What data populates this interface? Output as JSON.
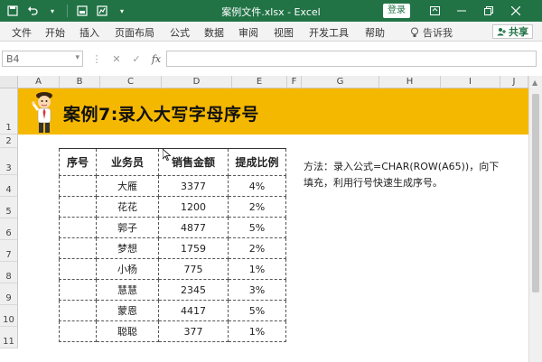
{
  "titlebar": {
    "doc_title": "案例文件.xlsx  -  Excel",
    "login_label": "登录"
  },
  "ribbon": {
    "tabs": [
      "文件",
      "开始",
      "插入",
      "页面布局",
      "公式",
      "数据",
      "审阅",
      "视图",
      "开发工具",
      "帮助"
    ],
    "tell_me": "告诉我",
    "share": "共享"
  },
  "formula_bar": {
    "name_box": "B4",
    "formula": ""
  },
  "columns": [
    "A",
    "B",
    "C",
    "D",
    "E",
    "F",
    "G",
    "H",
    "I",
    "J"
  ],
  "rows": [
    "1",
    "2",
    "3",
    "4",
    "5",
    "6",
    "7",
    "8",
    "9",
    "10",
    "11"
  ],
  "banner": {
    "title": "案例7:录入大写字母序号"
  },
  "table": {
    "headers": [
      "序号",
      "业务员",
      "销售金额",
      "提成比例"
    ],
    "rows": [
      [
        "",
        "大雁",
        "3377",
        "4%"
      ],
      [
        "",
        "花花",
        "1200",
        "2%"
      ],
      [
        "",
        "郭子",
        "4877",
        "5%"
      ],
      [
        "",
        "梦想",
        "1759",
        "2%"
      ],
      [
        "",
        "小杨",
        "775",
        "1%"
      ],
      [
        "",
        "慧慧",
        "2345",
        "3%"
      ],
      [
        "",
        "蒙恩",
        "4417",
        "5%"
      ],
      [
        "",
        "聪聪",
        "377",
        "1%"
      ]
    ]
  },
  "note": {
    "line1": "方法：录入公式=CHAR(ROW(A65))，向下",
    "line2": "填充，利用行号快速生成序号。"
  },
  "colors": {
    "excel_green": "#217346",
    "banner_yellow": "#f5b800"
  }
}
